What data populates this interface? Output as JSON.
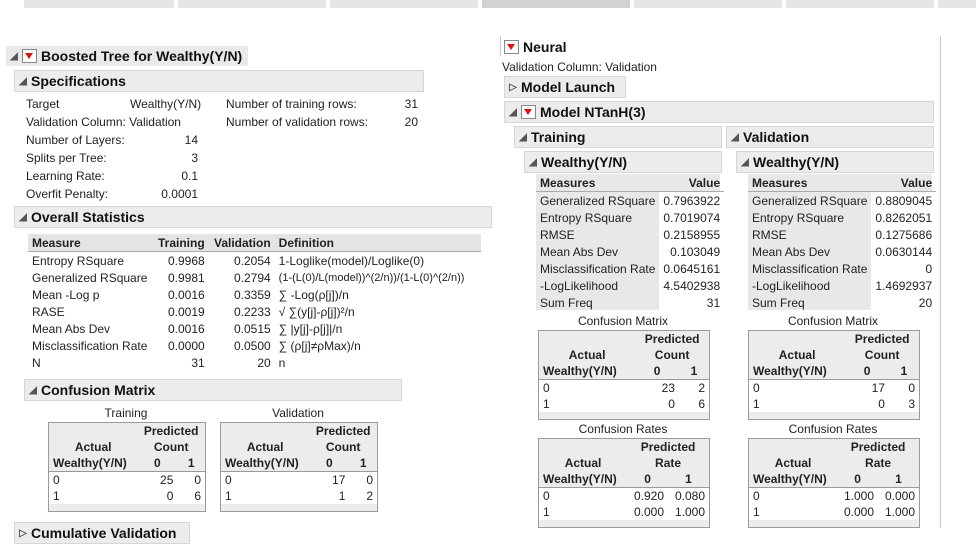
{
  "boosted": {
    "title": "Boosted Tree for Wealthy(Y/N)",
    "specifications": {
      "title": "Specifications",
      "left": [
        {
          "label": "Target",
          "value": "Wealthy(Y/N)"
        },
        {
          "label": "Validation Column: Validation",
          "value": ""
        },
        {
          "label": "Number of Layers:",
          "value": "14"
        },
        {
          "label": "Splits per Tree:",
          "value": "3"
        },
        {
          "label": "Learning Rate:",
          "value": "0.1"
        },
        {
          "label": "Overfit Penalty:",
          "value": "0.0001"
        }
      ],
      "right": [
        {
          "label": "Number of training rows:",
          "value": "31"
        },
        {
          "label": "Number of validation rows:",
          "value": "20"
        }
      ]
    },
    "overall": {
      "title": "Overall Statistics",
      "columns": [
        "Measure",
        "Training",
        "Validation",
        "Definition"
      ],
      "rows": [
        [
          "Entropy RSquare",
          "0.9968",
          "0.2054",
          "1-Loglike(model)/Loglike(0)"
        ],
        [
          "Generalized RSquare",
          "0.9981",
          "0.2794",
          "(1-(L(0)/L(model))^(2/n))/(1-L(0)^(2/n))"
        ],
        [
          "Mean -Log p",
          "0.0016",
          "0.3359",
          "∑ -Log(ρ[j])/n"
        ],
        [
          "RASE",
          "0.0019",
          "0.2233",
          "√ ∑(y[j]-ρ[j])²/n"
        ],
        [
          "Mean Abs Dev",
          "0.0016",
          "0.0515",
          "∑ |y[j]-ρ[j]|/n"
        ],
        [
          "Misclassification Rate",
          "0.0000",
          "0.0500",
          "∑ (ρ[j]≠ρMax)/n"
        ],
        [
          "N",
          "31",
          "20",
          "n"
        ]
      ]
    },
    "confusion": {
      "title": "Confusion Matrix",
      "training": {
        "caption": "Training",
        "predicted": "Predicted",
        "stat": "Count",
        "actual": "Actual",
        "var": "Wealthy(Y/N)",
        "cols": [
          "0",
          "1"
        ],
        "rows": [
          [
            "0",
            "25",
            "0"
          ],
          [
            "1",
            "0",
            "6"
          ]
        ]
      },
      "validation": {
        "caption": "Validation",
        "predicted": "Predicted",
        "stat": "Count",
        "actual": "Actual",
        "var": "Wealthy(Y/N)",
        "cols": [
          "0",
          "1"
        ],
        "rows": [
          [
            "0",
            "17",
            "0"
          ],
          [
            "1",
            "1",
            "2"
          ]
        ]
      }
    },
    "cumulative": "Cumulative Validation"
  },
  "neural": {
    "title": "Neural",
    "validation_column": "Validation Column: Validation",
    "model_launch": "Model Launch",
    "model_title": "Model NTanH(3)",
    "training": {
      "title": "Training",
      "sub": "Wealthy(Y/N)",
      "measures_header": [
        "Measures",
        "Value"
      ],
      "measures": [
        [
          "Generalized RSquare",
          "0.7963922"
        ],
        [
          "Entropy RSquare",
          "0.7019074"
        ],
        [
          "RMSE",
          "0.2158955"
        ],
        [
          "Mean Abs Dev",
          "0.103049"
        ],
        [
          "Misclassification Rate",
          "0.0645161"
        ],
        [
          "-LogLikelihood",
          "4.5402938"
        ],
        [
          "Sum Freq",
          "31"
        ]
      ],
      "cm_count": {
        "caption": "Confusion Matrix",
        "predicted": "Predicted",
        "stat": "Count",
        "actual": "Actual",
        "var": "Wealthy(Y/N)",
        "cols": [
          "0",
          "1"
        ],
        "rows": [
          [
            "0",
            "23",
            "2"
          ],
          [
            "1",
            "0",
            "6"
          ]
        ]
      },
      "cm_rate": {
        "caption": "Confusion Rates",
        "predicted": "Predicted",
        "stat": "Rate",
        "actual": "Actual",
        "var": "Wealthy(Y/N)",
        "cols": [
          "0",
          "1"
        ],
        "rows": [
          [
            "0",
            "0.920",
            "0.080"
          ],
          [
            "1",
            "0.000",
            "1.000"
          ]
        ]
      }
    },
    "validation": {
      "title": "Validation",
      "sub": "Wealthy(Y/N)",
      "measures_header": [
        "Measures",
        "Value"
      ],
      "measures": [
        [
          "Generalized RSquare",
          "0.8809045"
        ],
        [
          "Entropy RSquare",
          "0.8262051"
        ],
        [
          "RMSE",
          "0.1275686"
        ],
        [
          "Mean Abs Dev",
          "0.0630144"
        ],
        [
          "Misclassification Rate",
          "0"
        ],
        [
          "-LogLikelihood",
          "1.4692937"
        ],
        [
          "Sum Freq",
          "20"
        ]
      ],
      "cm_count": {
        "caption": "Confusion Matrix",
        "predicted": "Predicted",
        "stat": "Count",
        "actual": "Actual",
        "var": "Wealthy(Y/N)",
        "cols": [
          "0",
          "1"
        ],
        "rows": [
          [
            "0",
            "17",
            "0"
          ],
          [
            "1",
            "0",
            "3"
          ]
        ]
      },
      "cm_rate": {
        "caption": "Confusion Rates",
        "predicted": "Predicted",
        "stat": "Rate",
        "actual": "Actual",
        "var": "Wealthy(Y/N)",
        "cols": [
          "0",
          "1"
        ],
        "rows": [
          [
            "0",
            "1.000",
            "0.000"
          ],
          [
            "1",
            "0.000",
            "1.000"
          ]
        ]
      }
    }
  }
}
